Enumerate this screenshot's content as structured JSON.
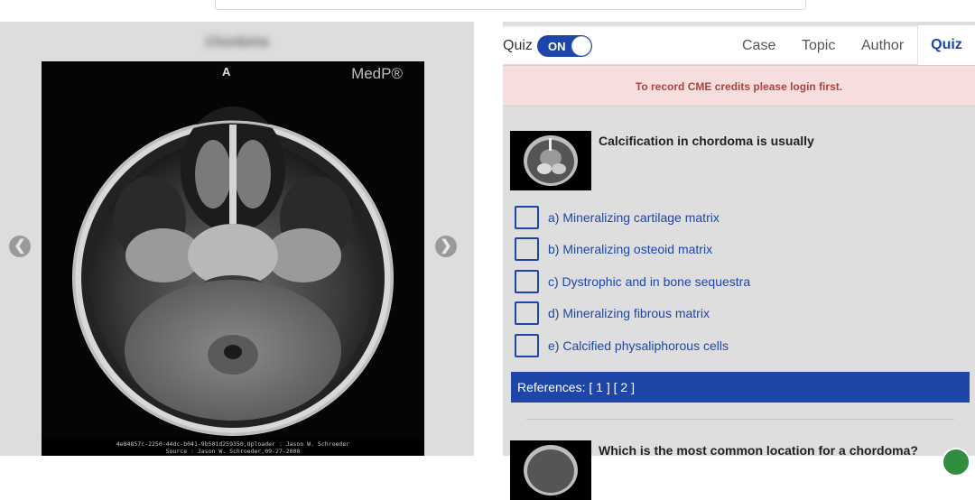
{
  "viewer": {
    "title": "Chordoma",
    "orientation_label": "A",
    "watermark": "MedP®",
    "caption_line1": "4e84857c-2250-44dc-b041-9b501d259350,Uploader : Jason W. Schroeder",
    "caption_line2": "Source : Jason W. Schroeder,09-27-2008",
    "prev_icon": "arrow-left-circle-icon",
    "next_icon": "arrow-right-circle-icon"
  },
  "panel": {
    "quiz_label": "Quiz",
    "toggle_state": "ON",
    "tabs": [
      "Case",
      "Topic",
      "Author"
    ],
    "active_tab": "Quiz",
    "alert": "To record CME credits please login first.",
    "question1": {
      "text": "Calcification in chordoma is usually",
      "options": [
        "a) Mineralizing cartilage matrix",
        "b) Mineralizing osteoid matrix",
        "c) Dystrophic and in bone sequestra",
        "d) Mineralizing fibrous matrix",
        "e) Calcified physaliphorous cells"
      ]
    },
    "references": {
      "label": "References:",
      "link1": "[ 1 ]",
      "link2": "[ 2 ]"
    },
    "question2": {
      "text": "Which is the most common location for a chordoma?"
    }
  },
  "colors": {
    "accent": "#1d46a8",
    "alert_bg": "#f7dede",
    "alert_text": "#a94442",
    "panel_bg": "#dedede"
  }
}
